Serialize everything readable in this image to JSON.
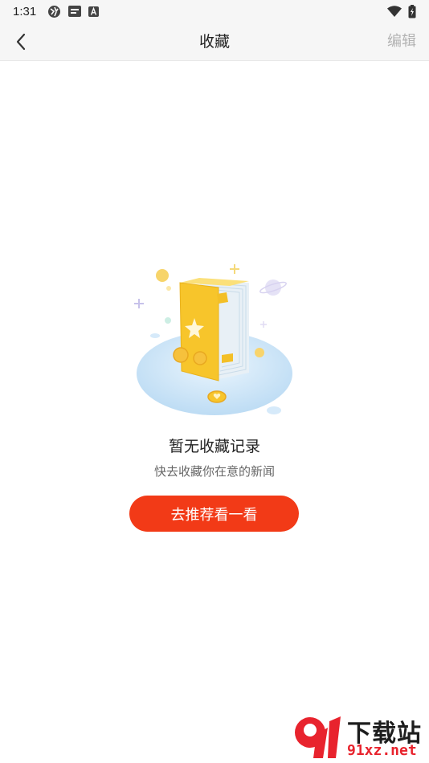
{
  "status_bar": {
    "time": "1:31",
    "left_icons": [
      "vpn-globe-icon",
      "news-app-icon",
      "a-letter-icon"
    ],
    "right_icons": [
      "wifi-icon",
      "battery-charging-icon"
    ]
  },
  "nav": {
    "title": "收藏",
    "edit_label": "编辑",
    "back_icon": "chevron-left-icon"
  },
  "empty_state": {
    "illustration": "yellow-book-star-illustration",
    "title": "暂无收藏记录",
    "subtitle": "快去收藏你在意的新闻",
    "button_label": "去推荐看一看"
  },
  "watermark": {
    "brand": "下载站",
    "domain": "91xz.net"
  },
  "colors": {
    "accent": "#f23a17",
    "nav_background": "#f6f6f6",
    "edit_text": "#b3b3b3",
    "book_yellow": "#f7c52b"
  }
}
